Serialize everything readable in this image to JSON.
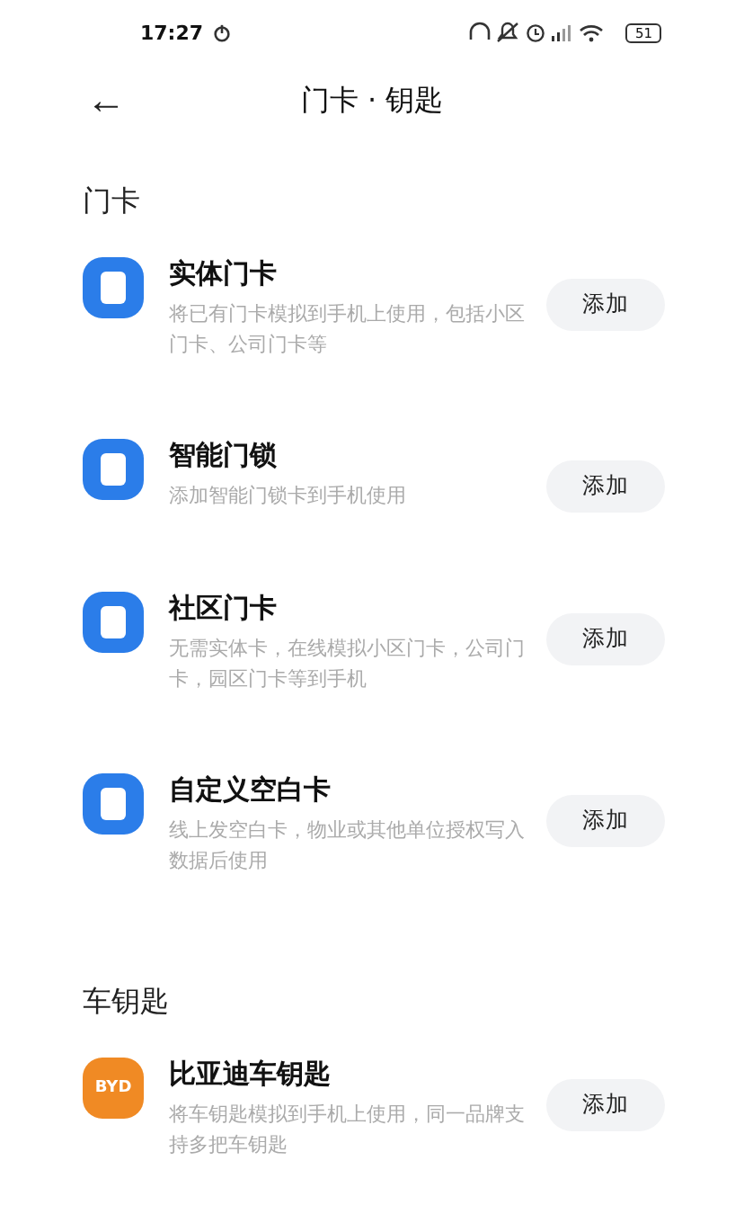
{
  "status_bar": {
    "time": "17:27",
    "battery": "51"
  },
  "header": {
    "back": "←",
    "title": "门卡 · 钥匙"
  },
  "sections": [
    {
      "title": "门卡",
      "items": [
        {
          "kind": "card",
          "name": "实体门卡",
          "description": "将已有门卡模拟到手机上使用，包括小区门卡、公司门卡等",
          "button": "添加"
        },
        {
          "kind": "card",
          "name": "智能门锁",
          "description": "添加智能门锁卡到手机使用",
          "button": "添加"
        },
        {
          "kind": "card",
          "name": "社区门卡",
          "description": "无需实体卡，在线模拟小区门卡，公司门卡，园区门卡等到手机",
          "button": "添加"
        },
        {
          "kind": "card",
          "name": "自定义空白卡",
          "description": "线上发空白卡，物业或其他单位授权写入数据后使用",
          "button": "添加"
        }
      ]
    },
    {
      "title": "车钥匙",
      "items": [
        {
          "kind": "brand",
          "logo": "BYD",
          "name": "比亚迪车钥匙",
          "description": "将车钥匙模拟到手机上使用，同一品牌支持多把车钥匙",
          "button": "添加"
        }
      ]
    }
  ]
}
